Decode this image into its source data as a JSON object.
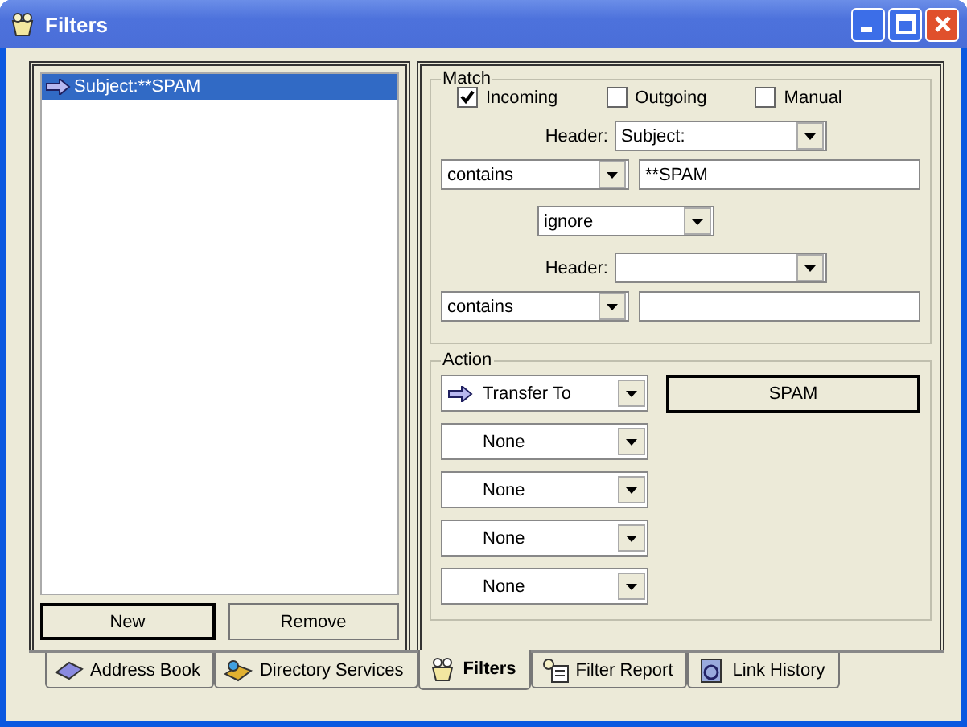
{
  "window": {
    "title": "Filters"
  },
  "filters": {
    "items": [
      {
        "label": "Subject:**SPAM",
        "selected": true
      }
    ],
    "buttons": [
      "New",
      "Remove"
    ]
  },
  "match": {
    "title": "Match",
    "checkboxes": [
      {
        "label": "Incoming",
        "checked": true
      },
      {
        "label": "Outgoing",
        "checked": false
      },
      {
        "label": "Manual",
        "checked": false
      }
    ],
    "header_1": {
      "label": "Header:",
      "value": "Subject:"
    },
    "condition_1": {
      "operator": "contains",
      "value": "**SPAM"
    },
    "joiner": "ignore",
    "header_2": {
      "label": "Header:"
    },
    "condition_2": {
      "operator": "contains"
    }
  },
  "action": {
    "title": "Action",
    "actions": [
      {
        "kind": "transfer",
        "label": "Transfer To"
      },
      {
        "kind": "none",
        "label": "None"
      },
      {
        "kind": "none",
        "label": "None"
      },
      {
        "kind": "none",
        "label": "None"
      },
      {
        "kind": "none",
        "label": "None"
      }
    ],
    "target": "SPAM"
  },
  "tabs": [
    {
      "label": "Address Book",
      "selected": false
    },
    {
      "label": "Directory Services",
      "selected": false
    },
    {
      "label": "Filters",
      "selected": true
    },
    {
      "label": "Filter Report",
      "selected": false
    },
    {
      "label": "Link History",
      "selected": false
    }
  ]
}
